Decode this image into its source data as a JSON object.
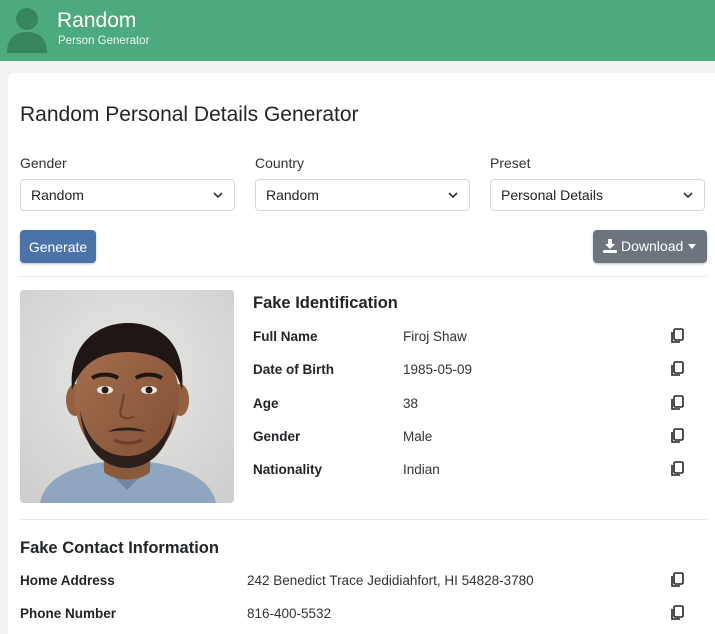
{
  "header": {
    "brand_title": "Random",
    "brand_subtitle": "Person Generator",
    "bar_color": "#4caa7e"
  },
  "page_title": "Random Personal Details Generator",
  "filters": [
    {
      "label": "Gender",
      "value": "Random"
    },
    {
      "label": "Country",
      "value": "Random"
    },
    {
      "label": "Preset",
      "value": "Personal Details"
    }
  ],
  "buttons": {
    "generate": "Generate",
    "download": "Download",
    "generate_color": "#4c73a8",
    "download_color": "#6c757d"
  },
  "identification": {
    "title": "Fake Identification",
    "rows": [
      {
        "label": "Full Name",
        "value": "Firoj Shaw"
      },
      {
        "label": "Date of Birth",
        "value": "1985-05-09"
      },
      {
        "label": "Age",
        "value": "38"
      },
      {
        "label": "Gender",
        "value": "Male"
      },
      {
        "label": "Nationality",
        "value": "Indian"
      }
    ]
  },
  "contact": {
    "title": "Fake Contact Information",
    "rows": [
      {
        "label": "Home Address",
        "value": "242 Benedict Trace Jedidiahfort, HI 54828-3780"
      },
      {
        "label": "Phone Number",
        "value": "816-400-5532"
      }
    ]
  },
  "icons": {
    "logo": "person-silhouette-icon",
    "select_arrow": "chevron-down-icon",
    "download": "download-icon",
    "copy": "copy-icon"
  }
}
